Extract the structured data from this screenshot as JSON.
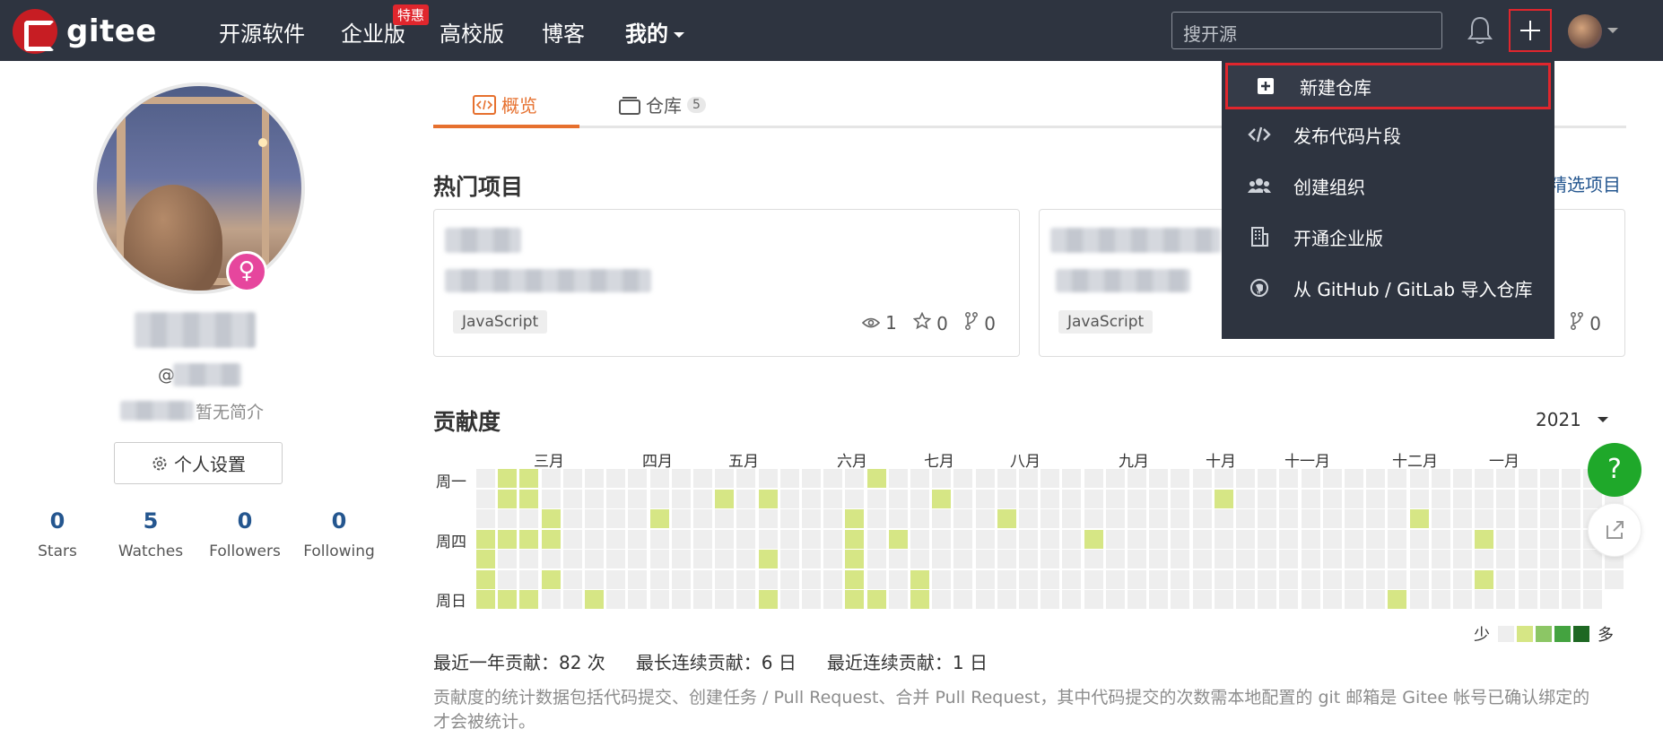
{
  "header": {
    "logo_text": "gitee",
    "nav": [
      "开源软件",
      "企业版",
      "高校版",
      "博客",
      "我的"
    ],
    "promo_badge": "特惠",
    "search_placeholder": "搜开源"
  },
  "dropdown": {
    "items": [
      {
        "label": "新建仓库",
        "icon": "plus-square-icon"
      },
      {
        "label": "发布代码片段",
        "icon": "code-icon"
      },
      {
        "label": "创建组织",
        "icon": "users-icon"
      },
      {
        "label": "开通企业版",
        "icon": "building-icon"
      },
      {
        "label": "从 GitHub / GitLab 导入仓库",
        "icon": "github-icon"
      }
    ]
  },
  "profile": {
    "username_prefix": "@",
    "bio": "暂无简介",
    "settings_button": "个人设置",
    "stats": [
      {
        "value": "0",
        "label": "Stars"
      },
      {
        "value": "5",
        "label": "Watches"
      },
      {
        "value": "0",
        "label": "Followers"
      },
      {
        "value": "0",
        "label": "Following"
      }
    ]
  },
  "tabs": [
    {
      "label": "概览",
      "active": true
    },
    {
      "label": "仓库",
      "count": "5"
    }
  ],
  "hot_projects": {
    "title": "热门项目",
    "select_link": "精选项目",
    "cards": [
      {
        "language": "JavaScript",
        "watches": "1",
        "stars": "0",
        "forks": "0"
      },
      {
        "language": "JavaScript",
        "forks": "0"
      }
    ]
  },
  "contribution": {
    "title": "贡献度",
    "year": "2021",
    "months": [
      "三月",
      "四月",
      "五月",
      "六月",
      "七月",
      "八月",
      "九月",
      "十月",
      "十一月",
      "十二月",
      "一月"
    ],
    "days": [
      "周一",
      "周四",
      "周日"
    ],
    "legend_less": "少",
    "legend_more": "多",
    "colors": [
      "#eeeeee",
      "#d6e685",
      "#8cc665",
      "#44a340",
      "#1e6823"
    ],
    "summary": [
      "最近一年贡献：82 次",
      "最长连续贡献：6 日",
      "最近连续贡献：1 日"
    ],
    "note": "贡献度的统计数据包括代码提交、创建任务 / Pull Request、合并 Pull Request，其中代码提交的次数需本地配置的 git 邮箱是 Gitee 帐号已确认绑定的才会被统计。"
  },
  "floating": {
    "help": "?"
  }
}
